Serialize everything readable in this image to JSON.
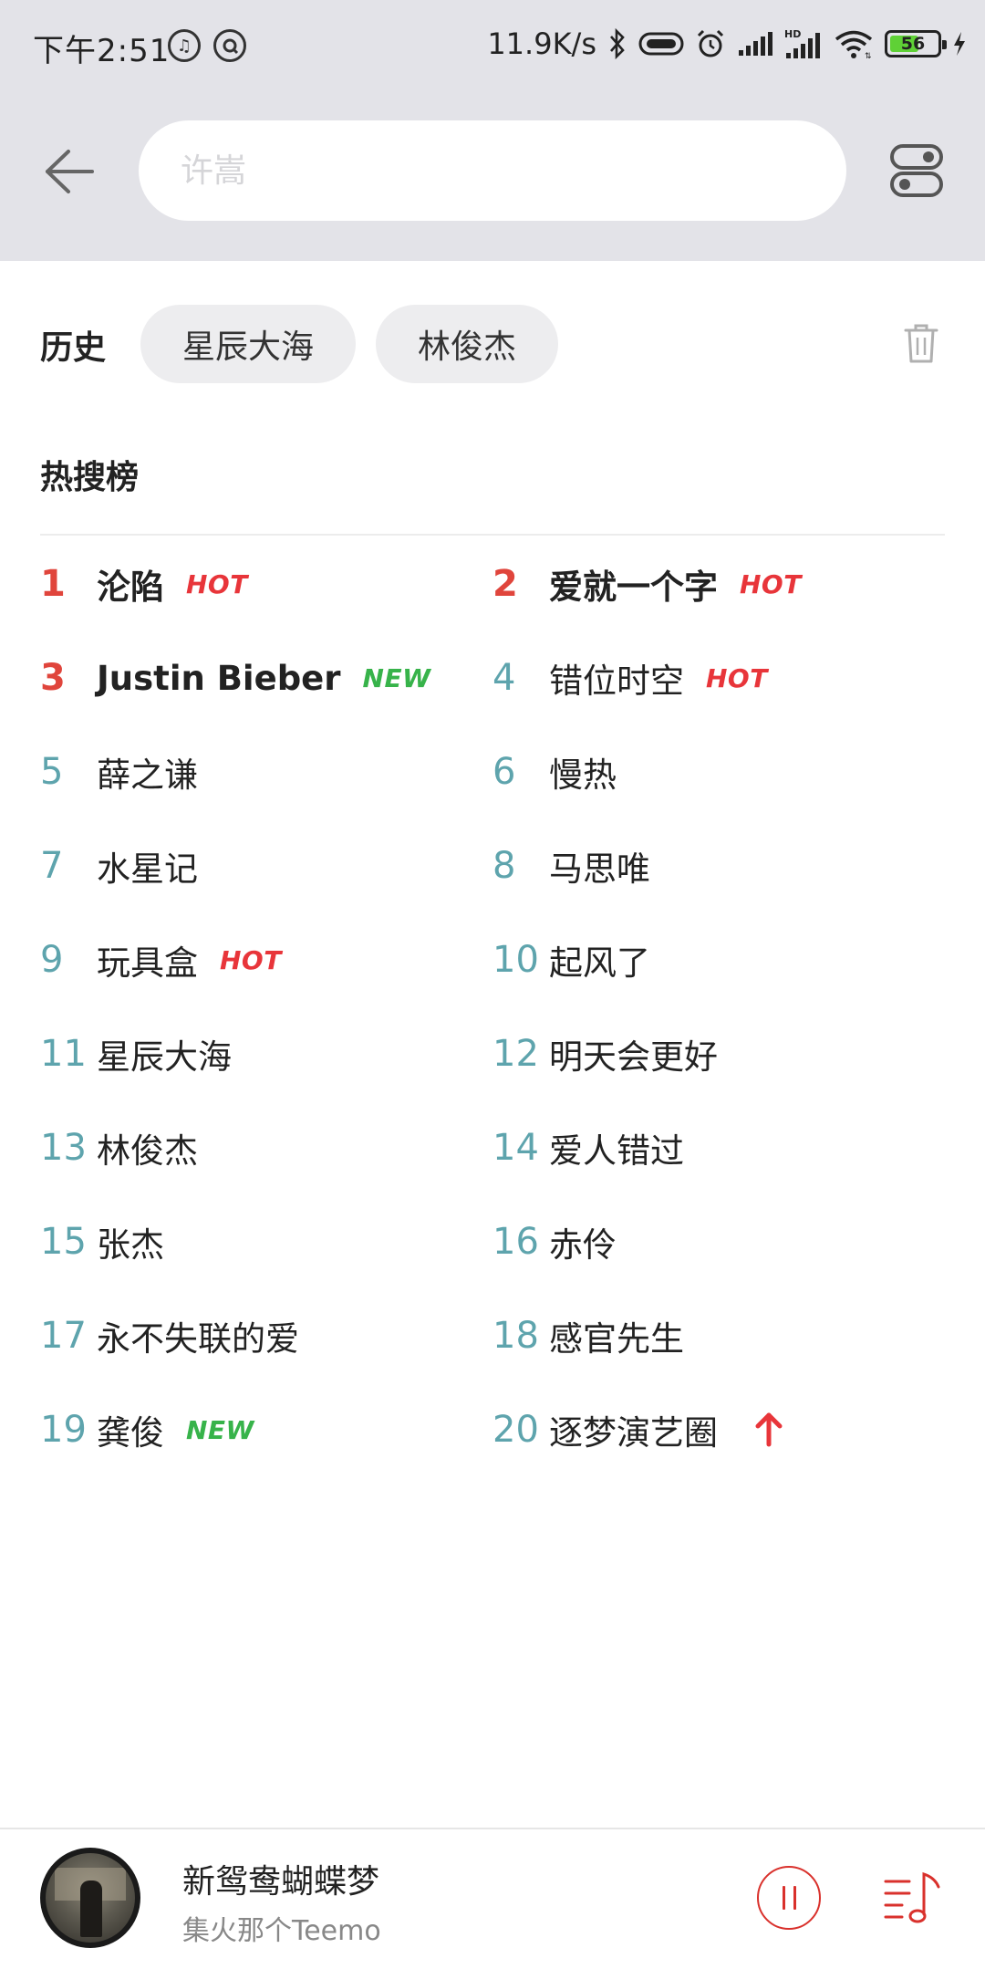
{
  "status_bar": {
    "time": "下午2:51",
    "net_speed": "11.9K/s",
    "battery_level": "56",
    "icons": [
      "music-notification-icon",
      "vpn-icon",
      "bluetooth-icon",
      "nfc-icon",
      "alarm-icon",
      "signal-icon",
      "hd-signal-icon",
      "wifi-icon",
      "battery-icon",
      "charging-icon"
    ]
  },
  "search": {
    "placeholder": "许嵩",
    "value": ""
  },
  "history": {
    "label": "历史",
    "items": [
      "星辰大海",
      "林俊杰"
    ]
  },
  "hot_search": {
    "title": "热搜榜",
    "items": [
      {
        "rank": "1",
        "name": "沦陷",
        "tag": "HOT"
      },
      {
        "rank": "2",
        "name": "爱就一个字",
        "tag": "HOT"
      },
      {
        "rank": "3",
        "name": "Justin Bieber",
        "tag": "NEW"
      },
      {
        "rank": "4",
        "name": "错位时空",
        "tag": "HOT"
      },
      {
        "rank": "5",
        "name": "薛之谦",
        "tag": ""
      },
      {
        "rank": "6",
        "name": "慢热",
        "tag": ""
      },
      {
        "rank": "7",
        "name": "水星记",
        "tag": ""
      },
      {
        "rank": "8",
        "name": "马思唯",
        "tag": ""
      },
      {
        "rank": "9",
        "name": "玩具盒",
        "tag": "HOT"
      },
      {
        "rank": "10",
        "name": "起风了",
        "tag": ""
      },
      {
        "rank": "11",
        "name": "星辰大海",
        "tag": ""
      },
      {
        "rank": "12",
        "name": "明天会更好",
        "tag": ""
      },
      {
        "rank": "13",
        "name": "林俊杰",
        "tag": ""
      },
      {
        "rank": "14",
        "name": "爱人错过",
        "tag": ""
      },
      {
        "rank": "15",
        "name": "张杰",
        "tag": ""
      },
      {
        "rank": "16",
        "name": "赤伶",
        "tag": ""
      },
      {
        "rank": "17",
        "name": "永不失联的爱",
        "tag": ""
      },
      {
        "rank": "18",
        "name": "感官先生",
        "tag": ""
      },
      {
        "rank": "19",
        "name": "龚俊",
        "tag": "NEW"
      },
      {
        "rank": "20",
        "name": "逐梦演艺圈",
        "tag": "up-arrow-icon"
      }
    ]
  },
  "player": {
    "song_title": "新鸳鸯蝴蝶梦",
    "artist": "集火那个Teemo"
  },
  "colors": {
    "accent_red": "#e0453c",
    "rank_teal": "#5ea4ad",
    "new_green": "#37b34a",
    "header_bg": "#e3e3e8"
  }
}
